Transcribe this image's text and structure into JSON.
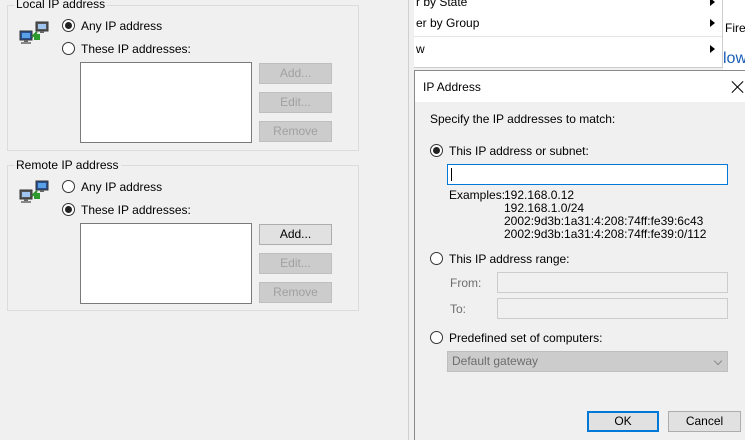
{
  "local_ip": {
    "group_title": "Local IP address",
    "any_label": "Any IP address",
    "these_label": "These IP addresses:",
    "selected": "any",
    "buttons": {
      "add": "Add...",
      "edit": "Edit...",
      "remove": "Remove"
    }
  },
  "remote_ip": {
    "group_title": "Remote IP address",
    "any_label": "Any IP address",
    "these_label": "These IP addresses:",
    "selected": "these",
    "buttons": {
      "add": "Add...",
      "edit": "Edit...",
      "remove": "Remove"
    }
  },
  "context_menu": {
    "items": [
      {
        "label": "r by State",
        "has_submenu": true
      },
      {
        "label": "er by Group",
        "has_submenu": true
      },
      {
        "label": "w",
        "has_submenu": true
      }
    ]
  },
  "background_strip": {
    "text1": "Firev",
    "text2": "low"
  },
  "ip_dialog": {
    "title": "IP Address",
    "instruction": "Specify the IP addresses to match:",
    "option_subnet_label": "This IP address or subnet:",
    "subnet_value": "",
    "examples_label": "Examples:",
    "examples": [
      "192.168.0.12",
      "192.168.1.0/24",
      "2002:9d3b:1a31:4:208:74ff:fe39:6c43",
      "2002:9d3b:1a31:4:208:74ff:fe39:0/112"
    ],
    "option_range_label": "This IP address range:",
    "from_label": "From:",
    "to_label": "To:",
    "option_predefined_label": "Predefined set of computers:",
    "predefined_selected": "Default gateway",
    "ok_label": "OK",
    "cancel_label": "Cancel",
    "selected_option": "subnet"
  }
}
